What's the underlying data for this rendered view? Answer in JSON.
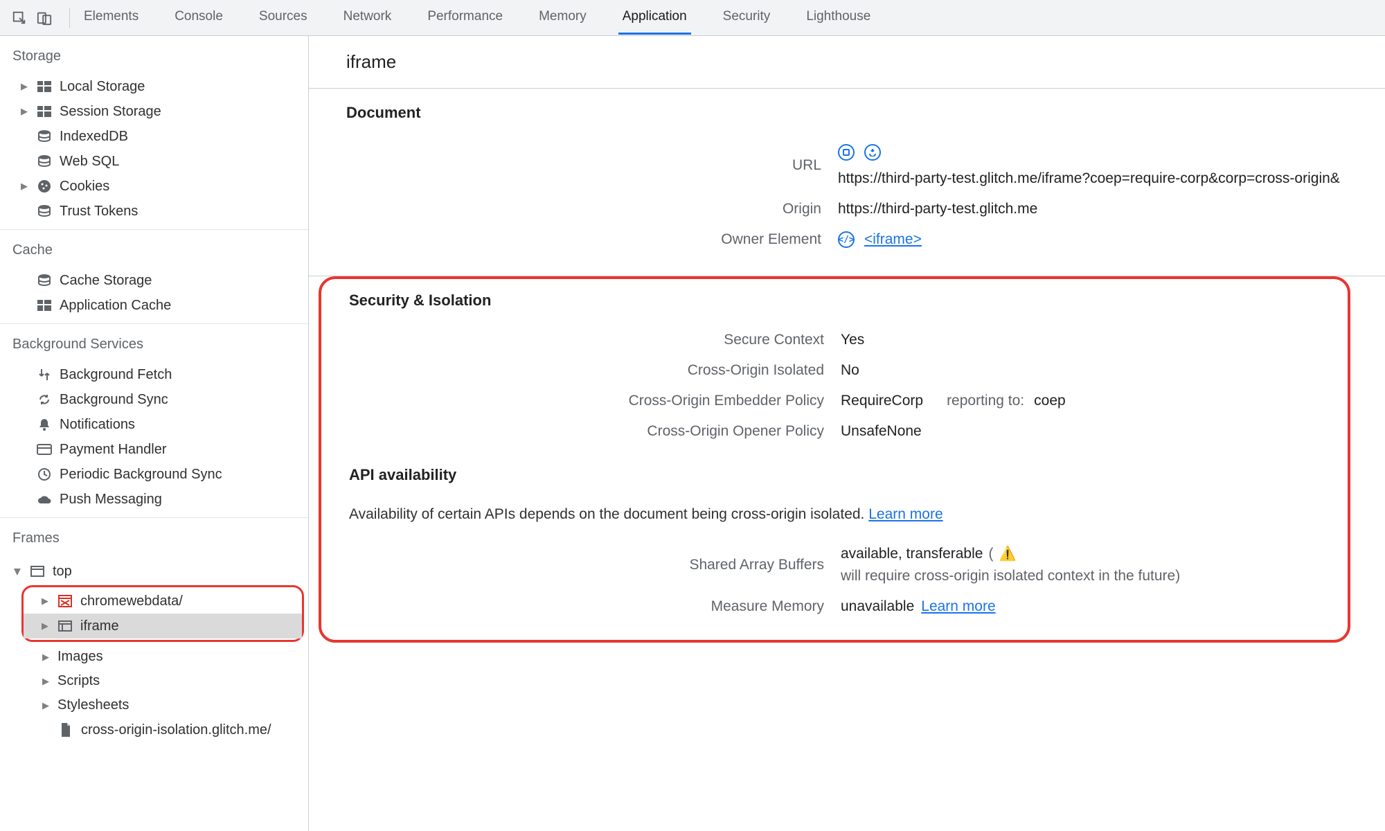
{
  "topbar": {
    "tabs": [
      "Elements",
      "Console",
      "Sources",
      "Network",
      "Performance",
      "Memory",
      "Application",
      "Security",
      "Lighthouse"
    ],
    "active_tab": "Application"
  },
  "sidebar": {
    "sections": {
      "storage": {
        "title": "Storage",
        "items": [
          {
            "label": "Local Storage",
            "expandable": true
          },
          {
            "label": "Session Storage",
            "expandable": true
          },
          {
            "label": "IndexedDB",
            "expandable": false
          },
          {
            "label": "Web SQL",
            "expandable": false
          },
          {
            "label": "Cookies",
            "expandable": true
          },
          {
            "label": "Trust Tokens",
            "expandable": false
          }
        ]
      },
      "cache": {
        "title": "Cache",
        "items": [
          {
            "label": "Cache Storage"
          },
          {
            "label": "Application Cache"
          }
        ]
      },
      "background": {
        "title": "Background Services",
        "items": [
          {
            "label": "Background Fetch"
          },
          {
            "label": "Background Sync"
          },
          {
            "label": "Notifications"
          },
          {
            "label": "Payment Handler"
          },
          {
            "label": "Periodic Background Sync"
          },
          {
            "label": "Push Messaging"
          }
        ]
      },
      "frames": {
        "title": "Frames",
        "top_label": "top",
        "highlighted": [
          {
            "label": "chromewebdata/",
            "icon": "blocked-frame"
          },
          {
            "label": "iframe",
            "icon": "frame",
            "selected": true
          }
        ],
        "children": [
          {
            "label": "Images"
          },
          {
            "label": "Scripts"
          },
          {
            "label": "Stylesheets"
          },
          {
            "label": "cross-origin-isolation.glitch.me/",
            "icon": "file"
          }
        ]
      }
    }
  },
  "main": {
    "title": "iframe",
    "document": {
      "heading": "Document",
      "url_label": "URL",
      "url_value": "https://third-party-test.glitch.me/iframe?coep=require-corp&corp=cross-origin&",
      "origin_label": "Origin",
      "origin_value": "https://third-party-test.glitch.me",
      "owner_label": "Owner Element",
      "owner_value": "<iframe>"
    },
    "security": {
      "heading": "Security & Isolation",
      "rows": {
        "secure_context": {
          "label": "Secure Context",
          "value": "Yes"
        },
        "coi": {
          "label": "Cross-Origin Isolated",
          "value": "No"
        },
        "coep": {
          "label": "Cross-Origin Embedder Policy",
          "value": "RequireCorp",
          "extra_label": "reporting to:",
          "extra_value": "coep"
        },
        "coop": {
          "label": "Cross-Origin Opener Policy",
          "value": "UnsafeNone"
        }
      }
    },
    "api": {
      "heading": "API availability",
      "desc": "Availability of certain APIs depends on the document being cross-origin isolated.",
      "learn_more": "Learn more",
      "sab": {
        "label": "Shared Array Buffers",
        "value": "available, transferable",
        "warn_open": "(",
        "warn_text": "will require cross-origin isolated context in the future)",
        "warn_icon": "⚠"
      },
      "mm": {
        "label": "Measure Memory",
        "value": "unavailable",
        "learn_more": "Learn more"
      }
    }
  }
}
